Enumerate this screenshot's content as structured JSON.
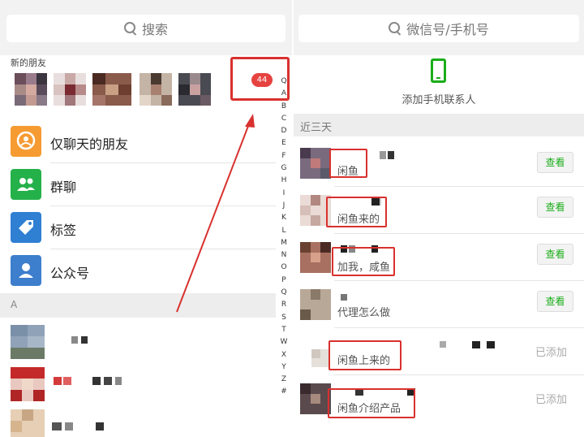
{
  "left_panel": {
    "search_placeholder": "搜索",
    "new_friends_title": "新的朋友",
    "badge_count": "44",
    "menu": [
      {
        "label": "仅聊天的朋友",
        "icon": "chat-only-friends-icon"
      },
      {
        "label": "群聊",
        "icon": "group-chat-icon"
      },
      {
        "label": "标签",
        "icon": "tag-icon"
      },
      {
        "label": "公众号",
        "icon": "official-account-icon"
      }
    ],
    "section_letter": "A",
    "index_letters": [
      "Q",
      "A",
      "B",
      "C",
      "D",
      "E",
      "F",
      "G",
      "H",
      "I",
      "J",
      "K",
      "L",
      "M",
      "N",
      "O",
      "P",
      "Q",
      "R",
      "S",
      "T",
      "W",
      "X",
      "Y",
      "Z",
      "#"
    ]
  },
  "right_panel": {
    "search_placeholder": "微信号/手机号",
    "add_phone_contacts": "添加手机联系人",
    "section_title": "近三天",
    "requests": [
      {
        "message": "闲鱼",
        "action": "查看"
      },
      {
        "message": "闲鱼来的",
        "action": "查看"
      },
      {
        "message": "加我，咸鱼",
        "action": "查看"
      },
      {
        "message": "代理怎么做",
        "action": "查看"
      },
      {
        "message": "闲鱼上来的",
        "action": "已添加"
      },
      {
        "message": "闲鱼介绍产品",
        "action": "已添加"
      }
    ]
  },
  "colors": {
    "highlight_red": "#d8312e",
    "wechat_green": "#1aad19",
    "badge_red": "#e64340"
  }
}
